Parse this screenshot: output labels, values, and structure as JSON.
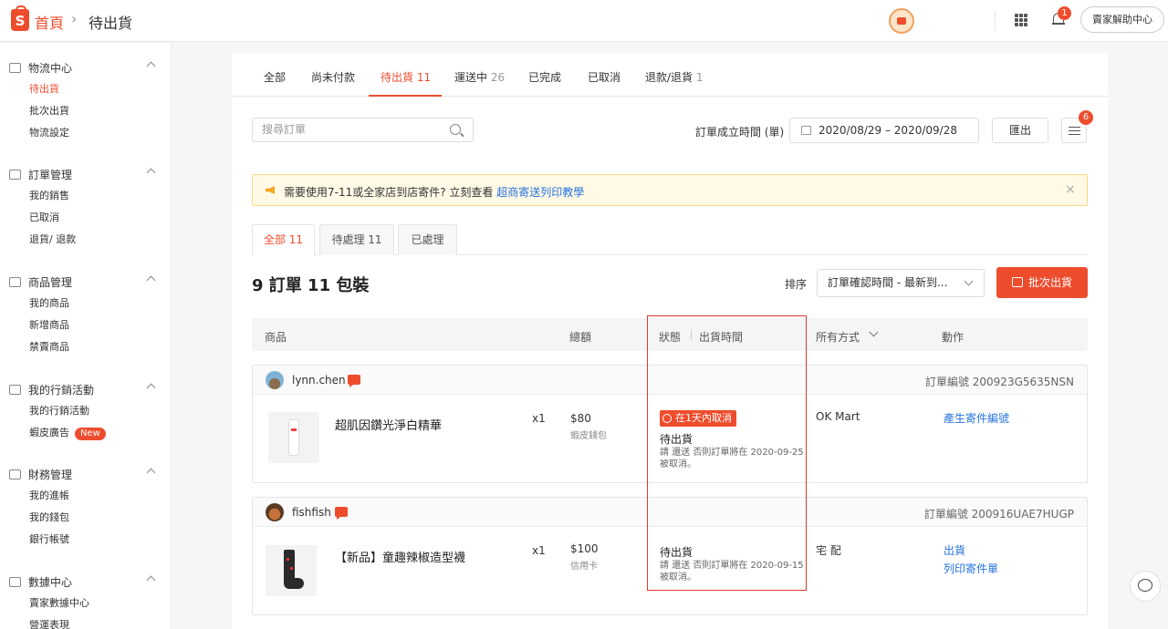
{
  "header": {
    "home": "首頁",
    "separator": "›",
    "current": "待出貨",
    "notif_count": "1",
    "help_label": "賣家解助中心"
  },
  "sidebar": {
    "groups": [
      {
        "title": "物流中心",
        "icon": "truck-icon",
        "items": [
          "待出貨",
          "批次出貨",
          "物流設定"
        ]
      },
      {
        "title": "訂單管理",
        "icon": "clipboard-icon",
        "items": [
          "我的銷售",
          "已取消",
          "退貨/ 退款"
        ]
      },
      {
        "title": "商品管理",
        "icon": "box-icon",
        "items": [
          "我的商品",
          "新增商品",
          "禁賣商品"
        ]
      },
      {
        "title": "我的行銷活動",
        "icon": "tag-icon",
        "items": [
          "我的行銷活動",
          "蝦皮廣告"
        ],
        "badge": "New"
      },
      {
        "title": "財務管理",
        "icon": "wallet-icon",
        "items": [
          "我的進帳",
          "我的錢包",
          "銀行帳號"
        ]
      },
      {
        "title": "數據中心",
        "icon": "chart-icon",
        "items": [
          "賣家數據中心",
          "營運表現"
        ]
      }
    ]
  },
  "tabs": [
    {
      "label": "全部",
      "count": ""
    },
    {
      "label": "尚未付款",
      "count": ""
    },
    {
      "label": "待出貨",
      "count": "11"
    },
    {
      "label": "運送中",
      "count": "26"
    },
    {
      "label": "已完成",
      "count": ""
    },
    {
      "label": "已取消",
      "count": ""
    },
    {
      "label": "退款/退貨",
      "count": "1"
    }
  ],
  "toolbar": {
    "search_placeholder": "搜尋訂單",
    "date_label": "訂單成立時間 (單)",
    "date_range": "2020/08/29 – 2020/09/28",
    "export_label": "匯出",
    "menu_badge": "6"
  },
  "notice": {
    "text": "需要使用7-11或全家店到店寄件? 立刻查看",
    "link": "超商寄送列印教學",
    "close": "×"
  },
  "subtabs": [
    {
      "label": "全部",
      "count": "11"
    },
    {
      "label": "待處理",
      "count": "11"
    },
    {
      "label": "已處理",
      "count": ""
    }
  ],
  "summary": {
    "count_text": "9 訂單 11 包裝",
    "sort_label": "排序",
    "sort_value": "訂單確認時間 - 最新到...",
    "batch_label": "批次出貨"
  },
  "table_headers": {
    "product": "商品",
    "total": "總額",
    "status": "狀態",
    "ship_time": "出貨時間",
    "method": "所有方式",
    "action": "動作"
  },
  "orders": [
    {
      "buyer": "lynn.chen",
      "order_no": "訂單編號 200923G5635NSN",
      "product": "超肌因鑽光淨白精華",
      "qty": "x1",
      "price": "$80",
      "payment": "蝦皮錢包",
      "deadline": "在1天內取消",
      "status": "待出貨",
      "note": "請 還送 否則訂單將在 2020-09-25 被取消。",
      "carrier": "OK Mart",
      "actions": [
        "產生寄件編號"
      ]
    },
    {
      "buyer": "fishfish",
      "order_no": "訂單編號 200916UAE7HUGP",
      "product": "【新品】童趣辣椒造型襪",
      "qty": "x1",
      "price": "$100",
      "payment": "信用卡",
      "deadline": "",
      "status": "待出貨",
      "note": "請 還送 否則訂單將在 2020-09-15 被取消。",
      "carrier": "宅 配",
      "actions": [
        "出貨",
        "列印寄件單"
      ]
    }
  ],
  "colors": {
    "accent": "#ee4d2d",
    "link": "#2673dd",
    "notice_bg": "#fff9e6"
  }
}
